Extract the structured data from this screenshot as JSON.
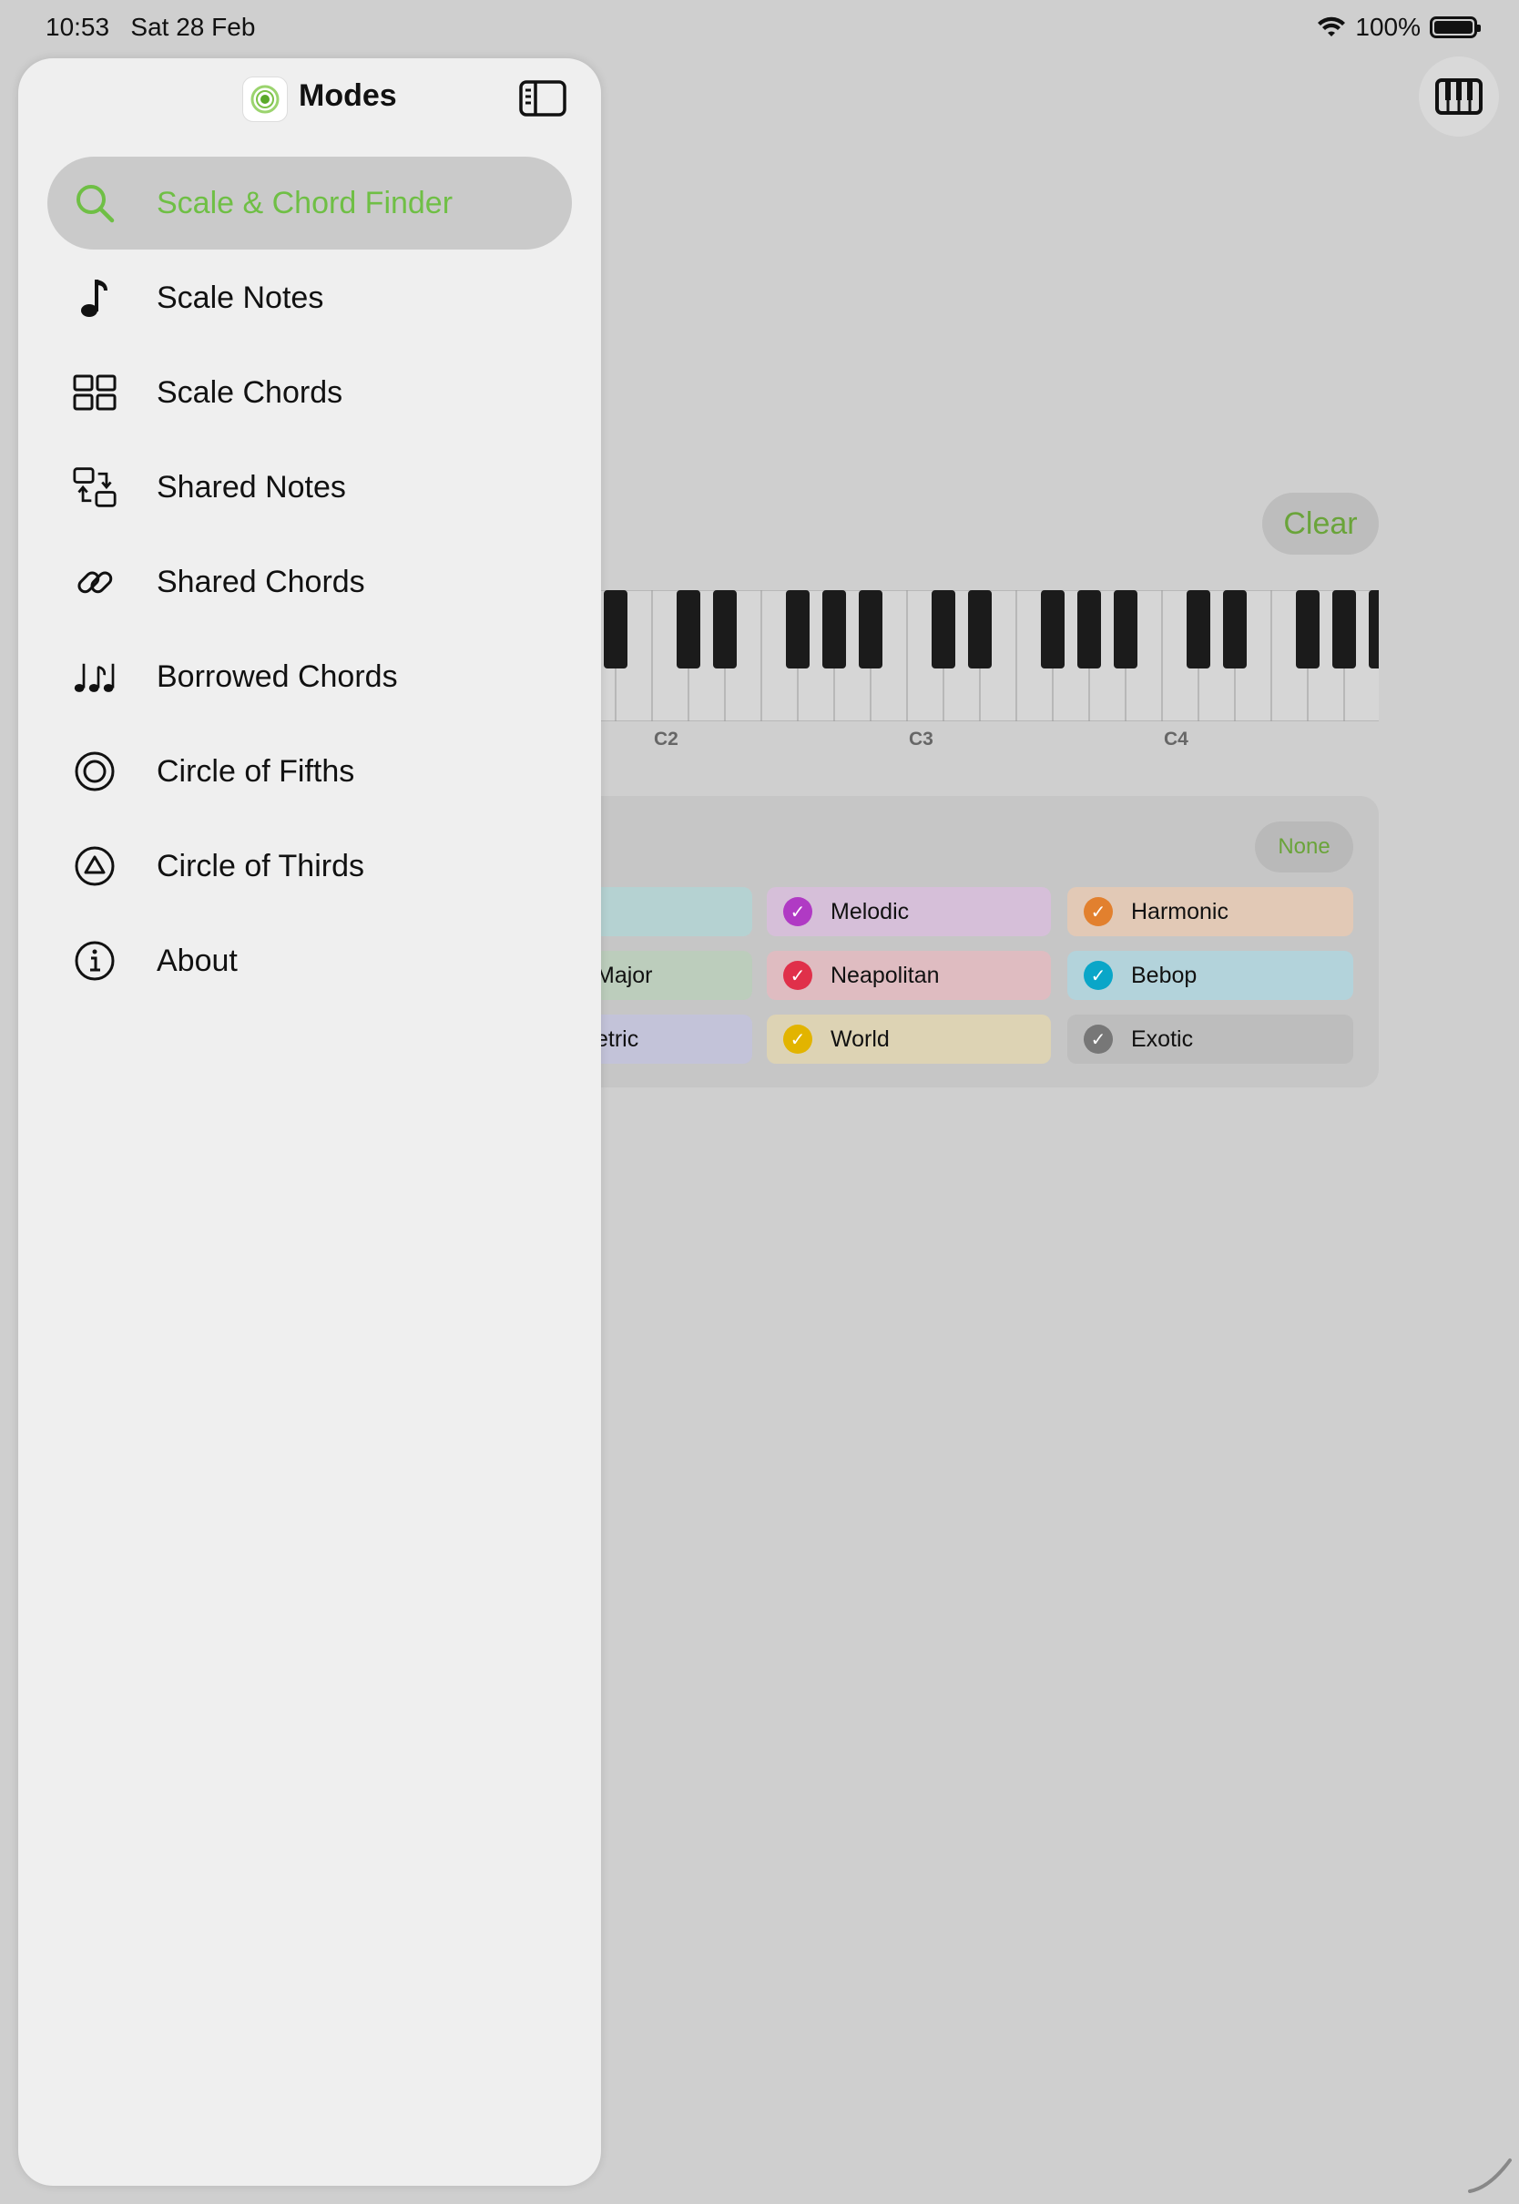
{
  "status_bar": {
    "time": "10:53",
    "date": "Sat 28 Feb",
    "battery": "100%"
  },
  "background": {
    "clear_label": "Clear",
    "octave_labels": [
      "C2",
      "C3",
      "C4"
    ],
    "none_label": "None",
    "chips": [
      {
        "label": "Melodic",
        "color": "#b03ac4"
      },
      {
        "label": "Harmonic",
        "color": "#e2802e"
      },
      {
        "label": "Neapolitan",
        "color": "#e0304a"
      },
      {
        "label": "Bebop",
        "color": "#0aa6c8"
      },
      {
        "label": "World",
        "color": "#e2b400"
      },
      {
        "label": "Exotic",
        "color": "#777777"
      }
    ],
    "partial_chips": [
      "Major",
      "etric"
    ]
  },
  "sidebar": {
    "title": "Modes",
    "items": [
      {
        "label": "Scale & Chord Finder",
        "icon": "magnifying-glass-icon",
        "selected": true
      },
      {
        "label": "Scale Notes",
        "icon": "music-note-icon"
      },
      {
        "label": "Scale Chords",
        "icon": "grid-icon"
      },
      {
        "label": "Shared Notes",
        "icon": "swap-squares-icon"
      },
      {
        "label": "Shared Chords",
        "icon": "link-icon"
      },
      {
        "label": "Borrowed Chords",
        "icon": "music-notes-icon"
      },
      {
        "label": "Circle of Fifths",
        "icon": "circle-icon"
      },
      {
        "label": "Circle of Thirds",
        "icon": "triangle-circle-icon"
      },
      {
        "label": "About",
        "icon": "info-icon"
      }
    ]
  },
  "colors": {
    "accent": "#6fbf45"
  }
}
